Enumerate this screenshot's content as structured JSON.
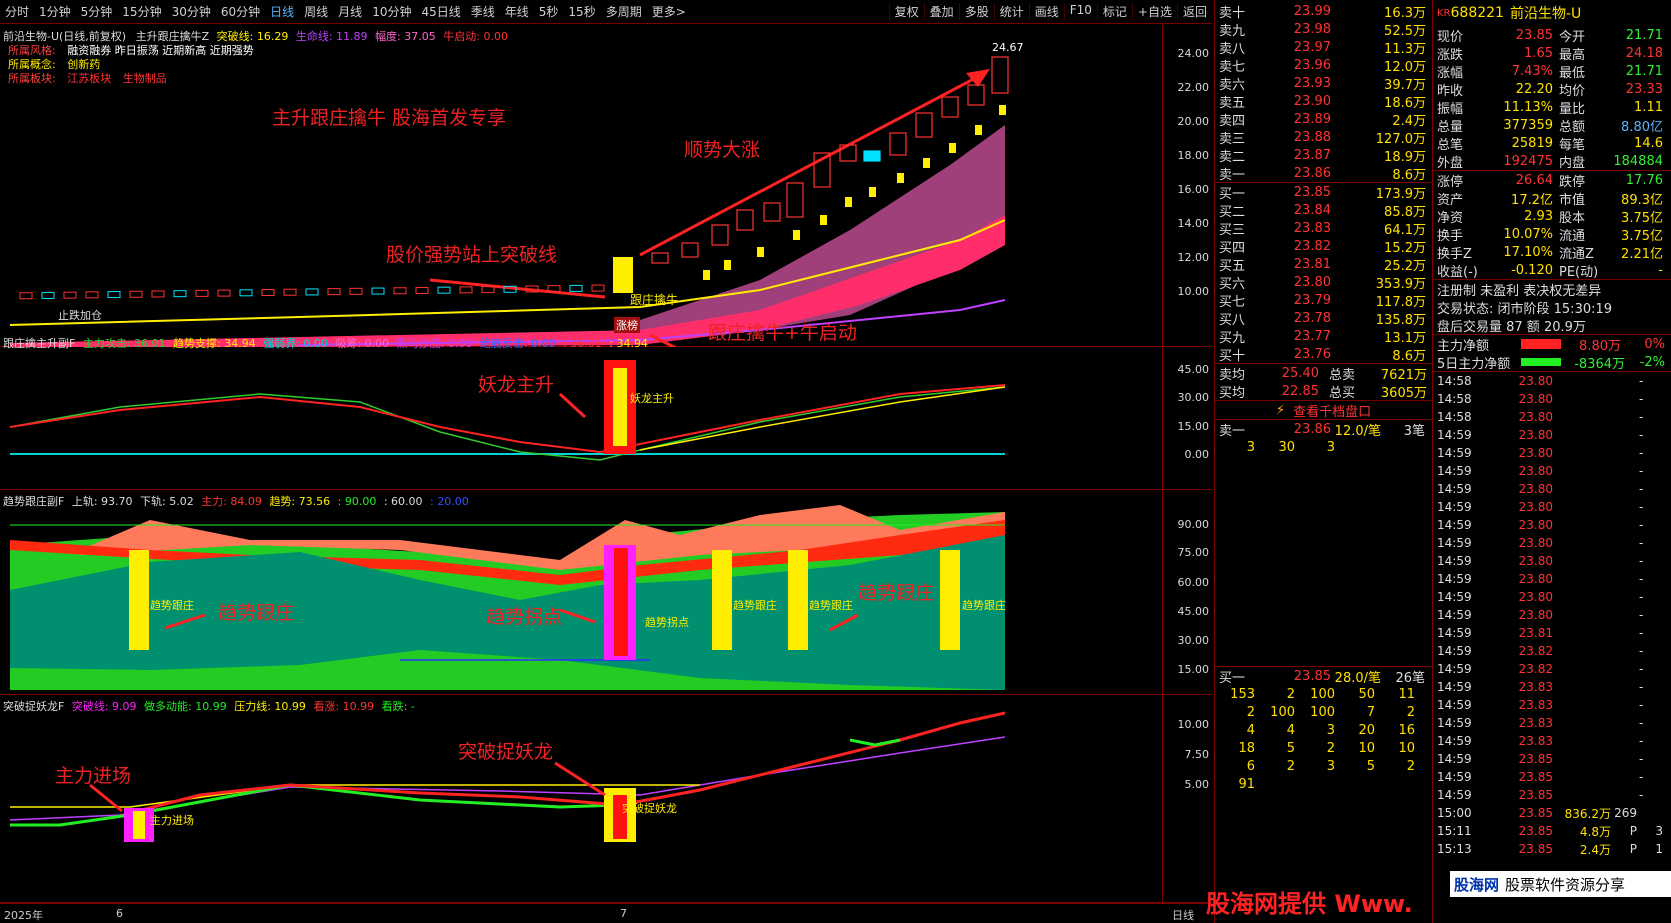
{
  "toolbar": {
    "tabs": [
      "分时",
      "1分钟",
      "5分钟",
      "15分钟",
      "30分钟",
      "60分钟",
      "日线",
      "周线",
      "月线",
      "10分钟",
      "45日线",
      "季线",
      "年线",
      "5秒",
      "15秒",
      "多周期",
      "更多>"
    ],
    "right": [
      "复权",
      "叠加",
      "多股",
      "统计",
      "画线",
      "F10",
      "标记",
      "+自选",
      "返回"
    ]
  },
  "main": {
    "title": "前沿生物-U(日线,前复权)",
    "indicator": "主升跟庄擒牛Z",
    "breakout": "突破线: 16.29",
    "lifeline": "生命线: 11.89",
    "amplitude": "幅度: 37.05",
    "bull": "牛启动: 0.00",
    "style_label": "所属风格:",
    "style": "融资融券 昨日振荡 近期新高 近期强势",
    "concept_label": "所属概念:",
    "concept": "创新药",
    "sector_label": "所属板块:",
    "sector": "江苏板块",
    "sector2": "生物制品",
    "peak": "24.67",
    "yticks": [
      "24.00",
      "22.00",
      "20.00",
      "18.00",
      "16.00",
      "14.00",
      "12.00",
      "10.00"
    ],
    "a1": "主升跟庄擒牛  股海首发专享",
    "a2": "顺势大涨",
    "a3": "股价强势站上突破线",
    "a4": "跟庄擒牛+牛启动",
    "tag1": "跟庄擒牛",
    "tag2": "涨榜",
    "tag3": "止跌加仓"
  },
  "sub1": {
    "name": "跟庄擒主升副F",
    "f1": "主力攻击: 36.01",
    "f2": "趋势支撑: 34.94",
    "f3": "强弱界: 0.00",
    "f4": "吸筹: 0.00",
    "f5": "黑马抄底: 0.00",
    "f6": "绝底反击: 0.00",
    "f7": ": 36.01",
    "f8": ": 34.94",
    "yticks": [
      "45.00",
      "30.00",
      "15.00",
      "0.00"
    ],
    "a1": "妖龙主升",
    "tag": "妖龙主升"
  },
  "sub2": {
    "name": "趋势跟庄副F",
    "f1": "上轨: 93.70",
    "f2": "下轨: 5.02",
    "f3": "主力: 84.09",
    "f4": "趋势: 73.56",
    "f5": ": 90.00",
    "f6": ": 60.00",
    "f7": ": 20.00",
    "yticks": [
      "90.00",
      "75.00",
      "60.00",
      "45.00",
      "30.00",
      "15.00"
    ],
    "a1": "趋势跟庄",
    "a2": "趋势拐点",
    "a3": "趋势跟庄",
    "tag1": "趋势跟庄",
    "tag2": "趋势拐点"
  },
  "sub3": {
    "name": "突破捉妖龙F",
    "f1": "突破线: 9.09",
    "f2": "做多动能: 10.99",
    "f3": "压力线: 10.99",
    "f4": "看涨: 10.99",
    "f5": "看跌: -",
    "yticks": [
      "10.00",
      "7.50",
      "5.00"
    ],
    "a1": "主力进场",
    "a2": "突破捉妖龙",
    "tag1": "主力进场",
    "tag2": "突破捉妖龙"
  },
  "bottom": {
    "year": "2025年",
    "m1": "6",
    "m2": "7",
    "period": "日线"
  },
  "asks": [
    [
      "卖十",
      "23.99",
      "16.3万"
    ],
    [
      "卖九",
      "23.98",
      "52.5万"
    ],
    [
      "卖八",
      "23.97",
      "11.3万"
    ],
    [
      "卖七",
      "23.96",
      "12.0万"
    ],
    [
      "卖六",
      "23.93",
      "39.7万"
    ],
    [
      "卖五",
      "23.90",
      "18.6万"
    ],
    [
      "卖四",
      "23.89",
      "2.4万"
    ],
    [
      "卖三",
      "23.88",
      "127.0万"
    ],
    [
      "卖二",
      "23.87",
      "18.9万"
    ],
    [
      "卖一",
      "23.86",
      "8.6万"
    ]
  ],
  "bids": [
    [
      "买一",
      "23.85",
      "173.9万"
    ],
    [
      "买二",
      "23.84",
      "85.8万"
    ],
    [
      "买三",
      "23.83",
      "64.1万"
    ],
    [
      "买四",
      "23.82",
      "15.2万"
    ],
    [
      "买五",
      "23.81",
      "25.2万"
    ],
    [
      "买六",
      "23.80",
      "353.9万"
    ],
    [
      "买七",
      "23.79",
      "117.8万"
    ],
    [
      "买八",
      "23.78",
      "135.8万"
    ],
    [
      "买九",
      "23.77",
      "13.1万"
    ],
    [
      "买十",
      "23.76",
      "8.6万"
    ]
  ],
  "avg": [
    [
      "卖均",
      "25.40",
      "总卖",
      "7621万"
    ],
    [
      "买均",
      "22.85",
      "总买",
      "3605万"
    ]
  ],
  "qlink": "查看千档盘口",
  "sell1": {
    "label": "卖一",
    "price": "23.86",
    "vol": "12.0/笔",
    "cnt": "3笔",
    "detail": [
      "3",
      "30",
      "3"
    ]
  },
  "buy1": {
    "label": "买一",
    "price": "23.85",
    "vol": "28.0/笔",
    "cnt": "26笔",
    "rows": [
      [
        "153",
        "2",
        "100",
        "50",
        "11"
      ],
      [
        "2",
        "100",
        "100",
        "7",
        "2"
      ],
      [
        "4",
        "4",
        "3",
        "20",
        "16"
      ],
      [
        "18",
        "5",
        "2",
        "10",
        "10"
      ],
      [
        "6",
        "2",
        "3",
        "5",
        "2"
      ],
      [
        "91",
        "",
        "",
        "",
        ""
      ]
    ]
  },
  "stock": {
    "badge": "KR",
    "code": "688221",
    "name": "前沿生物-U"
  },
  "stats": [
    [
      "现价",
      "23.85",
      "今开",
      "21.71"
    ],
    [
      "涨跌",
      "1.65",
      "最高",
      "24.18"
    ],
    [
      "涨幅",
      "7.43%",
      "最低",
      "21.71"
    ],
    [
      "昨收",
      "22.20",
      "均价",
      "23.33"
    ],
    [
      "振幅",
      "11.13%",
      "量比",
      "1.11"
    ],
    [
      "总量",
      "377359",
      "总额",
      "8.80亿"
    ],
    [
      "总笔",
      "25819",
      "每笔",
      "14.6"
    ],
    [
      "外盘",
      "192475",
      "内盘",
      "184884"
    ]
  ],
  "stats2": [
    [
      "涨停",
      "26.64",
      "跌停",
      "17.76"
    ],
    [
      "资产",
      "17.2亿",
      "市值",
      "89.3亿"
    ],
    [
      "净资",
      "2.93",
      "股本",
      "3.75亿"
    ],
    [
      "换手",
      "10.07%",
      "流通",
      "3.75亿"
    ],
    [
      "换手Z",
      "17.10%",
      "流通Z",
      "2.21亿"
    ],
    [
      "收益(-)",
      "-0.120",
      "PE(动)",
      "-"
    ]
  ],
  "notes": [
    "注册制 未盈利 表决权无差异",
    "交易状态: 闭市阶段 15:30:19",
    "盘后交易量 87 额 20.9万"
  ],
  "flow": [
    [
      "主力净额",
      "8.80万",
      "0%"
    ],
    [
      "5日主力净额",
      "-8364万",
      "-2%"
    ]
  ],
  "ticks": [
    [
      "14:58",
      "23.80"
    ],
    [
      "14:58",
      "23.80"
    ],
    [
      "14:58",
      "23.80"
    ],
    [
      "14:59",
      "23.80"
    ],
    [
      "14:59",
      "23.80"
    ],
    [
      "14:59",
      "23.80"
    ],
    [
      "14:59",
      "23.80"
    ],
    [
      "14:59",
      "23.80"
    ],
    [
      "14:59",
      "23.80"
    ],
    [
      "14:59",
      "23.80"
    ],
    [
      "14:59",
      "23.80"
    ],
    [
      "14:59",
      "23.80"
    ],
    [
      "14:59",
      "23.80"
    ],
    [
      "14:59",
      "23.80"
    ],
    [
      "14:59",
      "23.81"
    ],
    [
      "14:59",
      "23.82"
    ],
    [
      "14:59",
      "23.82"
    ],
    [
      "14:59",
      "23.83"
    ],
    [
      "14:59",
      "23.83"
    ],
    [
      "14:59",
      "23.83"
    ],
    [
      "14:59",
      "23.83"
    ],
    [
      "14:59",
      "23.85"
    ],
    [
      "14:59",
      "23.85"
    ],
    [
      "14:59",
      "23.85"
    ],
    [
      "15:00",
      "23.85",
      "836.2万",
      "269"
    ],
    [
      "15:11",
      "23.85",
      "4.8万",
      "P",
      "3"
    ],
    [
      "15:13",
      "23.85",
      "2.4万",
      "P",
      "1"
    ]
  ],
  "watermark": "股海网提供 Www.",
  "watermark2": [
    "股海网",
    "股票软件资源分享"
  ]
}
